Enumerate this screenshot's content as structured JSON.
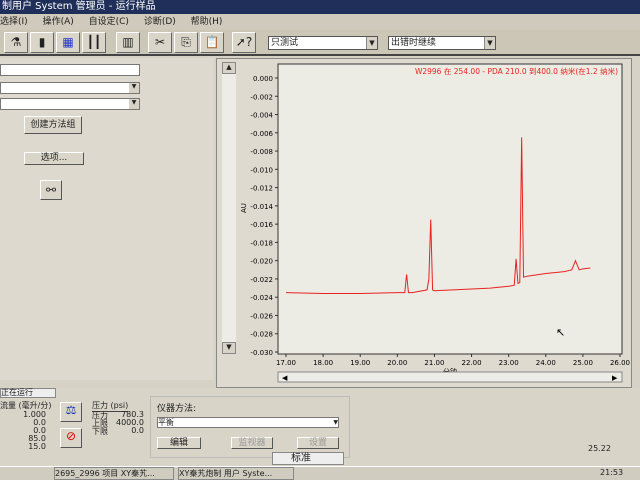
{
  "title": "制用户 System 管理员 - 运行样品",
  "menu": [
    "选择(I)",
    "操作(A)",
    "自设定(C)",
    "诊断(D)",
    "帮助(H)"
  ],
  "toolbar": {
    "icons": [
      "inject-icon",
      "vials-icon",
      "plate-icon",
      "columns-icon",
      "chart-icon",
      "cut-icon",
      "copy-icon",
      "paste-icon",
      "help-icon"
    ],
    "mode_select": "只测试",
    "run_select": "出错时继续"
  },
  "left": {
    "create_group": "创建方法组",
    "options": "选项..."
  },
  "chart_data": {
    "type": "line",
    "title": "W2996 在 254.00 - PDA 210.0 到400.0 纳米(在1.2 纳米)",
    "xlabel": "分钟",
    "ylabel": "AU",
    "xlim": [
      17,
      26
    ],
    "ylim": [
      -0.03,
      0.0
    ],
    "xticks": [
      "17.00",
      "18.00",
      "19.00",
      "20.00",
      "21.00",
      "22.00",
      "23.00",
      "24.00",
      "25.00",
      "26.00"
    ],
    "yticks": [
      "0.000",
      "-0.002",
      "-0.004",
      "-0.006",
      "-0.008",
      "-0.010",
      "-0.012",
      "-0.014",
      "-0.016",
      "-0.018",
      "-0.020",
      "-0.022",
      "-0.024",
      "-0.026",
      "-0.028",
      "-0.030"
    ],
    "color": "#e8231f",
    "x": [
      17.0,
      18.0,
      19.0,
      20.0,
      20.2,
      20.25,
      20.3,
      20.4,
      20.8,
      20.85,
      20.9,
      20.95,
      21.0,
      21.5,
      22.0,
      22.5,
      23.0,
      23.15,
      23.2,
      23.25,
      23.3,
      23.35,
      23.4,
      23.5,
      24.0,
      24.5,
      24.7,
      24.8,
      24.9,
      25.0,
      25.2
    ],
    "y": [
      -0.0235,
      -0.0236,
      -0.0236,
      -0.0235,
      -0.0235,
      -0.0215,
      -0.0235,
      -0.0235,
      -0.0232,
      -0.022,
      -0.0155,
      -0.0232,
      -0.0233,
      -0.0232,
      -0.0231,
      -0.023,
      -0.0228,
      -0.0227,
      -0.0198,
      -0.0225,
      -0.0224,
      -0.0065,
      -0.0218,
      -0.0217,
      -0.0214,
      -0.0212,
      -0.021,
      -0.02,
      -0.021,
      -0.0209,
      -0.0208
    ]
  },
  "bottom": {
    "tab": "正在运行",
    "flow_header": "流量 (毫升/分)",
    "flow_values": [
      "1.000",
      "0.0",
      "0.0",
      "85.0",
      "15.0"
    ],
    "pressure_header": "压力 (psi)",
    "pressure_rows": [
      {
        "label": "压力",
        "value": "780.3"
      },
      {
        "label": "上限",
        "value": "4000.0"
      },
      {
        "label": "下限",
        "value": "0.0"
      }
    ],
    "method_label": "仪器方法:",
    "method_value": "平衡",
    "edit": "编辑",
    "monitor": "监视器",
    "setup": "设置",
    "status": "标准"
  },
  "taskbar": {
    "items": [
      "2695_2996 项目 XY秦艽...",
      "XY秦艽炮制 用户 Syste..."
    ],
    "time": "21:53",
    "tray_time": "25.22"
  }
}
